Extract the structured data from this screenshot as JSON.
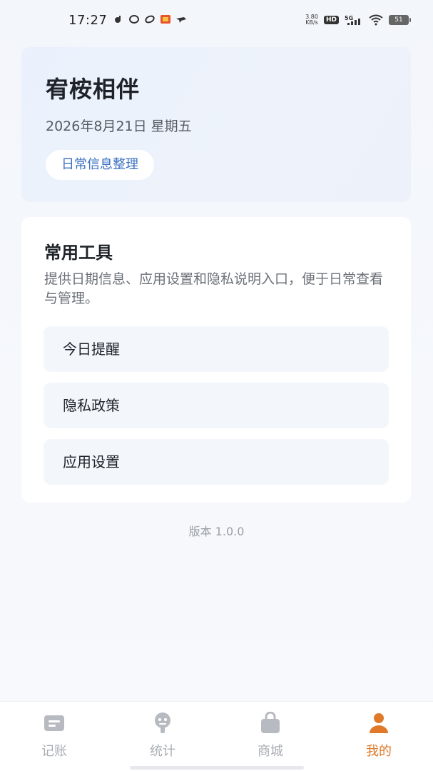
{
  "status_bar": {
    "time": "17:27",
    "net_speed_value": "3.80",
    "net_speed_unit": "KB/s",
    "hd": "HD",
    "network": "5G",
    "battery": "51"
  },
  "header": {
    "title": "宥桉相伴",
    "date": "2026年8月21日 星期五",
    "tag": "日常信息整理"
  },
  "tools": {
    "title": "常用工具",
    "description": "提供日期信息、应用设置和隐私说明入口，便于日常查看与管理。",
    "items": [
      {
        "label": "今日提醒"
      },
      {
        "label": "隐私政策"
      },
      {
        "label": "应用设置"
      }
    ]
  },
  "version": "版本 1.0.0",
  "bottom_nav": {
    "items": [
      {
        "label": "记账",
        "icon": "ledger-icon"
      },
      {
        "label": "统计",
        "icon": "stats-icon"
      },
      {
        "label": "商城",
        "icon": "shop-bag-icon"
      },
      {
        "label": "我的",
        "icon": "profile-icon"
      }
    ],
    "active_index": 3
  },
  "colors": {
    "accent": "#e07a2a",
    "tag_text": "#3a6fc0",
    "inactive_nav": "#a9adb3"
  }
}
